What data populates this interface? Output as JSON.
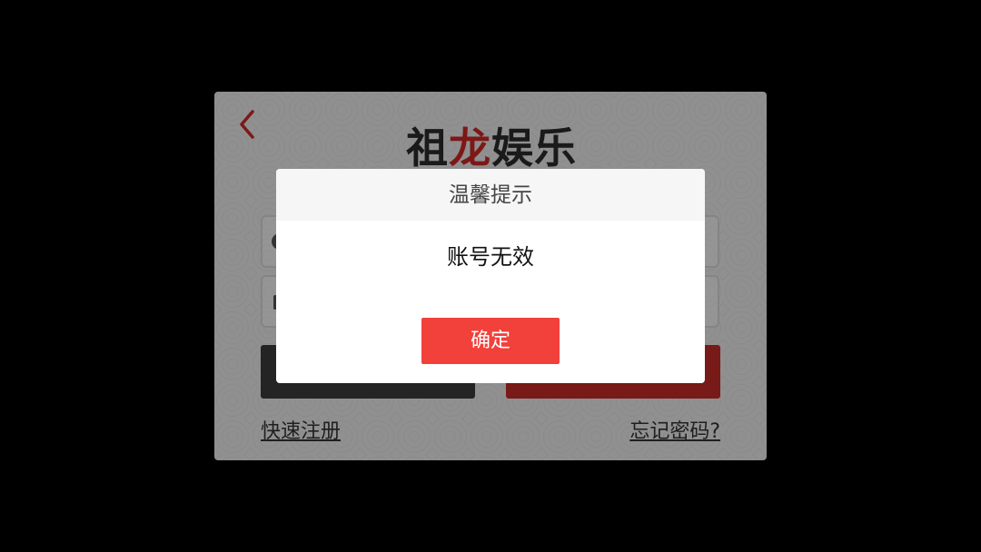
{
  "login": {
    "logo": {
      "part1": "祖",
      "part2": "龙",
      "part3": "娱乐"
    },
    "register_link": "快速注册",
    "forgot_link": "忘记密码?"
  },
  "dialog": {
    "title": "温馨提示",
    "message": "账号无效",
    "confirm_label": "确定"
  },
  "colors": {
    "accent_red": "#f2403b",
    "logo_red": "#c82824",
    "back_icon": "#c62a26"
  },
  "icons": {
    "back": "chevron-left-icon",
    "user": "user-icon",
    "lock": "lock-icon"
  }
}
